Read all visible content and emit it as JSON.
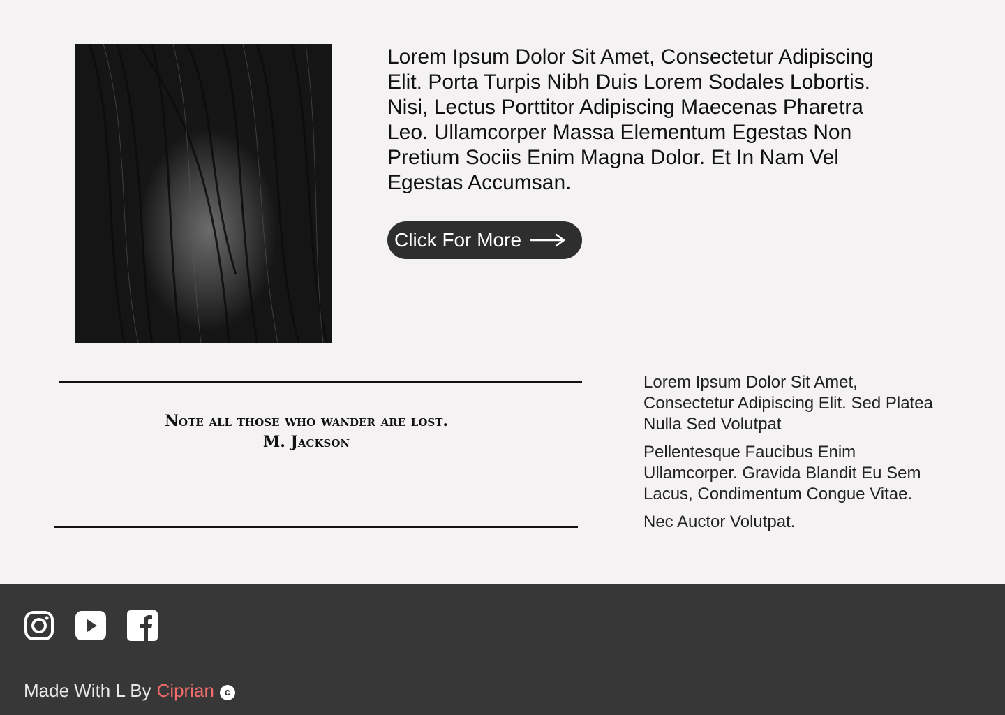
{
  "hero": {
    "image_alt": "portrait-photo",
    "paragraph": "Lorem Ipsum Dolor Sit Amet, Consectetur Adipiscing Elit. Porta Turpis Nibh Duis Lorem Sodales Lobortis. Nisi, Lectus Porttitor Adipiscing Maecenas Pharetra Leo. Ullamcorper Massa Elementum Egestas Non Pretium Sociis Enim Magna Dolor. Et In Nam Vel Egestas Accumsan.",
    "cta_label": "Click For More",
    "cta_icon": "arrow-right-icon"
  },
  "quote": {
    "text": "Note all those who wander are lost.",
    "author": "M. Jackson"
  },
  "side": {
    "paragraphs": [
      "Lorem Ipsum Dolor Sit Amet, Consectetur Adipiscing Elit. Sed Platea Nulla Sed Volutpat",
      "Pellentesque Faucibus Enim Ullamcorper. Gravida Blandit Eu Sem Lacus, Condimentum Congue Vitae.",
      "Nec Auctor Volutpat."
    ]
  },
  "footer": {
    "socials": [
      "instagram-icon",
      "youtube-icon",
      "facebook-icon"
    ],
    "credit_prefix": "Made With L By",
    "credit_author": "Ciprian",
    "copyright_symbol": "c",
    "background": "#373737",
    "accent": "#f06c6c"
  }
}
